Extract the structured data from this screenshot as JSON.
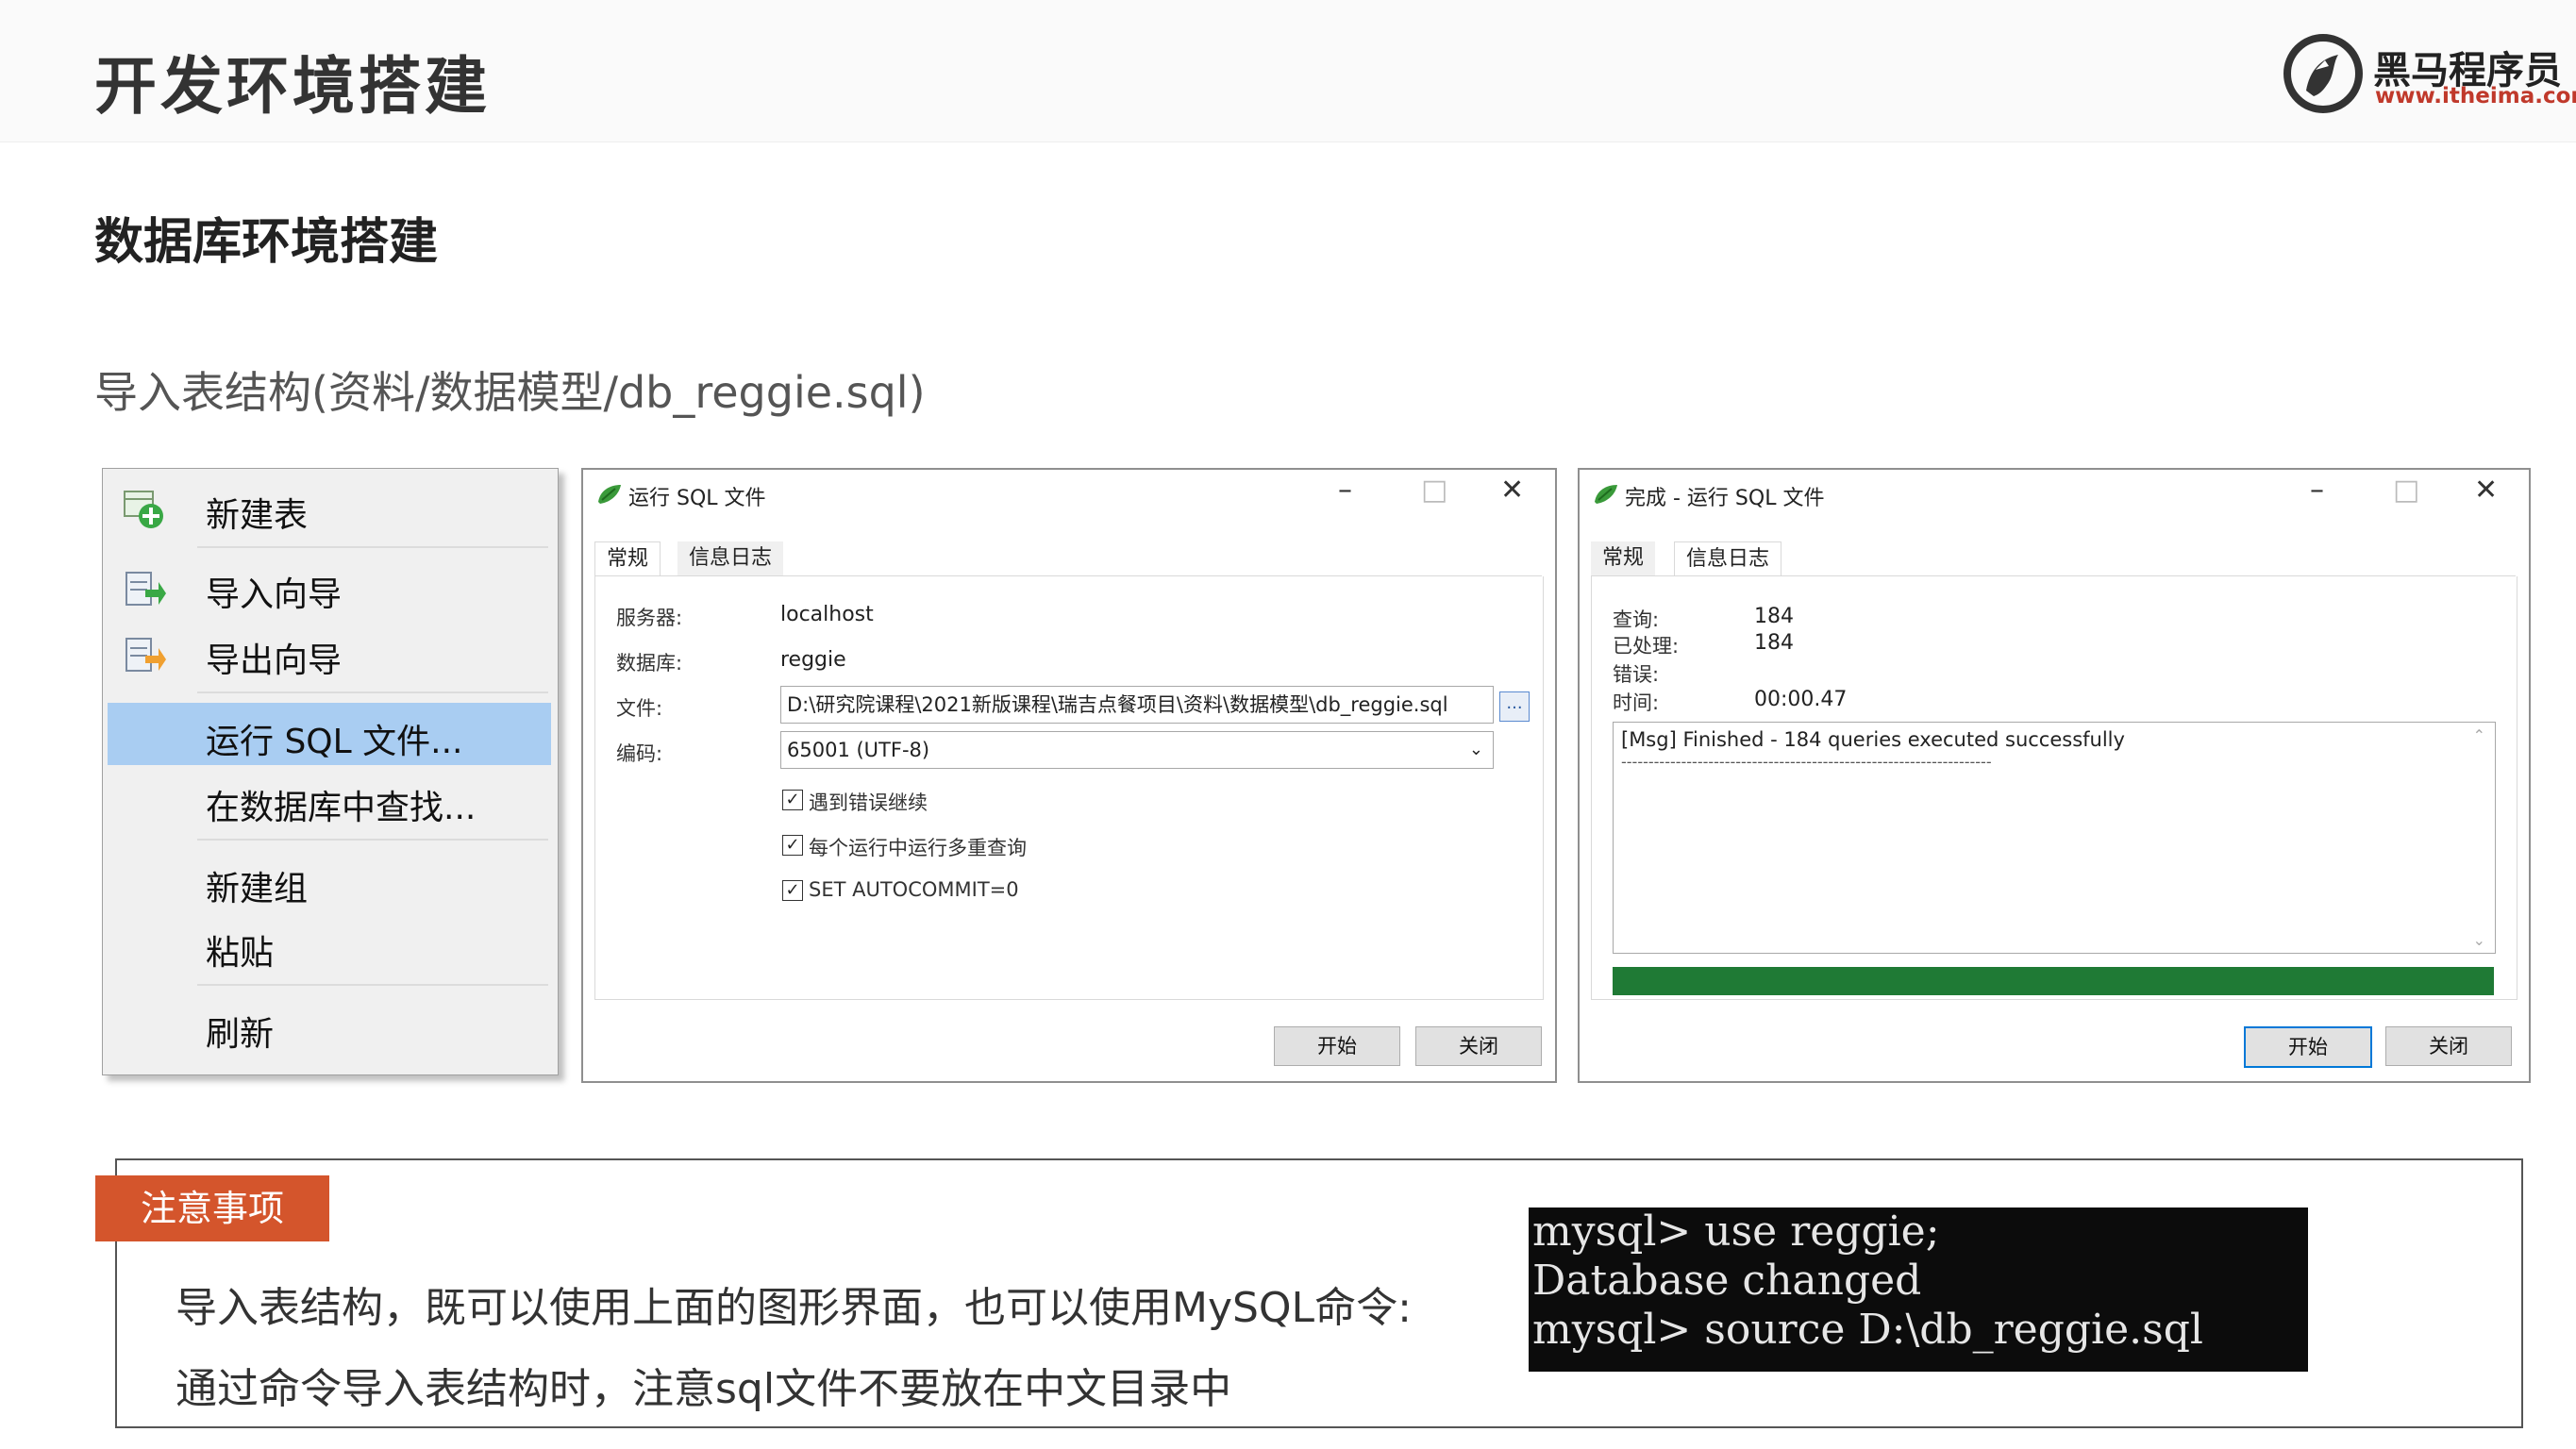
{
  "header": {
    "title": "开发环境搭建",
    "logo_name": "黑马程序员",
    "logo_url": "www.itheima.com"
  },
  "section_title": "数据库环境搭建",
  "subtitle": "导入表结构(资料/数据模型/db_reggie.sql)",
  "context_menu": {
    "items": [
      {
        "label": "新建表",
        "icon": "table-add-icon"
      },
      {
        "label": "导入向导",
        "icon": "import-wizard-icon"
      },
      {
        "label": "导出向导",
        "icon": "export-wizard-icon"
      },
      {
        "label": "运行 SQL 文件...",
        "selected": true
      },
      {
        "label": "在数据库中查找..."
      },
      {
        "label": "新建组"
      },
      {
        "label": "粘贴"
      },
      {
        "label": "刷新"
      }
    ]
  },
  "run_dialog": {
    "title": "运行 SQL 文件",
    "tabs": [
      "常规",
      "信息日志"
    ],
    "active_tab": "常规",
    "server_label": "服务器:",
    "server_value": "localhost",
    "database_label": "数据库:",
    "database_value": "reggie",
    "file_label": "文件:",
    "file_value": "D:\\研究院课程\\2021新版课程\\瑞吉点餐项目\\资料\\数据模型\\db_reggie.sql",
    "browse_label": "...",
    "encoding_label": "编码:",
    "encoding_value": "65001 (UTF-8)",
    "options": [
      {
        "label": "遇到错误继续",
        "checked": true
      },
      {
        "label": "每个运行中运行多重查询",
        "checked": true
      },
      {
        "label": "SET AUTOCOMMIT=0",
        "checked": true
      }
    ],
    "start_button": "开始",
    "close_button": "关闭"
  },
  "done_dialog": {
    "title": "完成 - 运行 SQL 文件",
    "tabs": [
      "常规",
      "信息日志"
    ],
    "active_tab": "信息日志",
    "query_label": "查询:",
    "query_value": "184",
    "processed_label": "已处理:",
    "processed_value": "184",
    "error_label": "错误:",
    "error_value": "",
    "time_label": "时间:",
    "time_value": "00:00.47",
    "log_line": "[Msg] Finished - 184 queries executed successfully",
    "log_separator": "--------------------------------------------------------------------",
    "progress": 1.0,
    "progress_color": "#1f7a35",
    "start_button": "开始",
    "close_button": "关闭"
  },
  "note": {
    "tag": "注意事项",
    "line1": "导入表结构，既可以使用上面的图形界面，也可以使用MySQL命令:",
    "line2": "通过命令导入表结构时，注意sql文件不要放在中文目录中",
    "terminal_lines": [
      "mysql> use reggie;",
      "Database changed",
      "mysql> source D:\\db_reggie.sql"
    ]
  },
  "colors": {
    "accent_tag": "#d4552c",
    "selection": "#a9cdf2",
    "default_button_border": "#0078d7"
  }
}
